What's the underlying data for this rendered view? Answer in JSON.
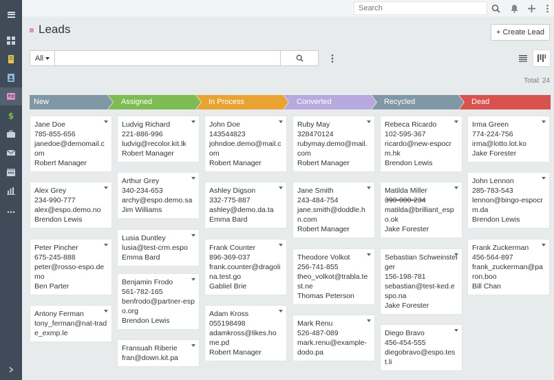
{
  "topbar": {
    "search_placeholder": "Search"
  },
  "page": {
    "title": "Leads",
    "create_label": "+ Create Lead",
    "filter_all": "All",
    "total": "Total: 24"
  },
  "colors": {
    "new": "#8197a6",
    "assigned": "#7fbb53",
    "in_process": "#e9a332",
    "converted": "#b7a9dd",
    "recycled": "#8197a6",
    "dead": "#d8534f"
  },
  "columns": [
    {
      "title": "New",
      "cards": [
        {
          "lines": [
            "Jane Doe",
            "785-855-656",
            "janedoe@demomail.com",
            "Robert Manager"
          ]
        },
        {
          "lines": [
            "Alex Grey",
            "234-990-777",
            "alex@espo.demo.no",
            "Brendon Lewis"
          ]
        },
        {
          "lines": [
            "Peter Pincher",
            "675-245-888",
            "peter@rosso-espo.demo",
            "Ben Parter"
          ]
        },
        {
          "lines": [
            "Antony Ferman",
            "tony_ferman@nat-trade_exmp.le"
          ]
        }
      ]
    },
    {
      "title": "Assigned",
      "cards": [
        {
          "lines": [
            "Ludvig Richard",
            "221-886-996",
            "ludvig@recolor.kit.lk",
            "Robert Manager"
          ]
        },
        {
          "lines": [
            "Arthur Grey",
            "340-234-653",
            "archy@espo.demo.sa",
            "Jim Williams"
          ]
        },
        {
          "lines": [
            "Lusia Duntley",
            "lusia@test-crm.espo",
            "Emma Bard"
          ]
        },
        {
          "lines": [
            "Benjamin Frodo",
            "561-782-165",
            "benfrodo@partner-espo.org",
            "Brendon Lewis"
          ]
        },
        {
          "lines": [
            "Fransuah Riberie",
            "fran@down.kit.pa"
          ]
        }
      ]
    },
    {
      "title": "In Process",
      "cards": [
        {
          "lines": [
            "John Doe",
            "143544823",
            "johndoe.demo@mail.com",
            "Robert Manager"
          ]
        },
        {
          "lines": [
            "Ashley Digson",
            "332-775-887",
            "ashley@demo.da.ta",
            "Emma Bard"
          ]
        },
        {
          "lines": [
            "Frank Counter",
            "896-369-037",
            "frank.counter@dragolina.test.go",
            "Gabliel Brie"
          ]
        },
        {
          "lines": [
            "Adam Kross",
            "055198498",
            "adamkross@likes.home.pd",
            "Robert Manager"
          ]
        }
      ]
    },
    {
      "title": "Converted",
      "cards": [
        {
          "lines": [
            "Ruby May",
            "328470124",
            "rubymay.demo@mail.com",
            "Robert Manager"
          ]
        },
        {
          "lines": [
            "Jane Smith",
            "243-484-754",
            "jane.smith@doddle.hn.com",
            "Robert Manager"
          ]
        },
        {
          "lines": [
            "Theodore Volkot",
            "256-741-855",
            "theo_volkot@trabla.test.ne",
            "Thomas Peterson"
          ]
        },
        {
          "lines": [
            "Mark Renu",
            "526-487-089",
            "mark.renu@example-dodo.pa"
          ]
        }
      ]
    },
    {
      "title": "Recycled",
      "cards": [
        {
          "lines": [
            "Rebeca Ricardo",
            "102-595-367",
            "ricardo@new-espocrm.hk",
            "Brendon Lewis"
          ]
        },
        {
          "lines": [
            "Matilda Miller",
            "390-000-234",
            "matilda@brilliant_espo.ok",
            "Jake Forester"
          ],
          "strike": 1
        },
        {
          "lines": [
            "Sebastian Schweinsteiger",
            "156-198-781",
            "sebastian@test-ked.espo.na",
            "Jake Forester"
          ]
        },
        {
          "lines": [
            "Diego Bravo",
            "456-454-555",
            "diegobravo@espo.test.li"
          ]
        }
      ]
    },
    {
      "title": "Dead",
      "cards": [
        {
          "lines": [
            "Irma Green",
            "774-224-756",
            "irma@lotto.lot.ko",
            "Jake Forester"
          ]
        },
        {
          "lines": [
            "John Lennon",
            "285-783-543",
            "lennon@bingo-espocrm.da",
            "Brendon Lewis"
          ]
        },
        {
          "lines": [
            "Frank Zuckerman",
            "456-564-897",
            "frank_zuckerman@paron.boo",
            "Bill Chan"
          ]
        }
      ]
    }
  ]
}
